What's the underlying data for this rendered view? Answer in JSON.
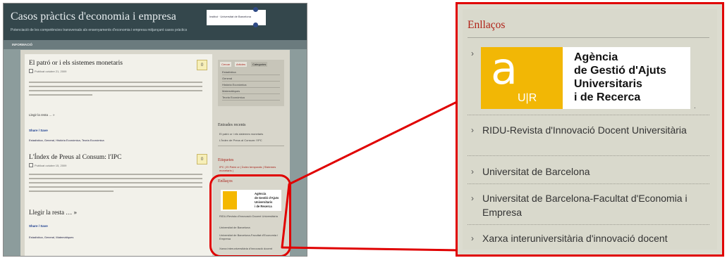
{
  "blog": {
    "title": "Casos pràctics d'economia i empresa",
    "subtitle": "Potenciació de les competències transversals als ensenyaments d'economia i empresa mitjançant casos pràctics",
    "nav": "INFORMACIÓ",
    "logo_text": "Institut · Universitat de Barcelona",
    "posts": [
      {
        "title": "El patró or i els sistemes monetaris",
        "date": "Publicat octubre 21, 2009",
        "comments": "0",
        "read_more": "Llegir la resta … »",
        "share": "Share / Save",
        "tags": "Estadística, General, Història Econòmica, Teoria Econòmica"
      },
      {
        "title": "L'Índex de Preus al Consum: l'IPC",
        "date": "Publicat octubre 15, 2009",
        "comments": "0",
        "read_more": "Llegir la resta … »",
        "share": "Share / Save",
        "tags": "Estadística, General, Matemàtiques"
      }
    ],
    "sidebar": {
      "tabs": [
        "Cercar",
        "Articles",
        "Categories"
      ],
      "categories": [
        "Estadística",
        "General",
        "Història Econòmica",
        "Matemàtiques",
        "Teoria Econòmica"
      ],
      "recent_heading": "Entrades recents",
      "recent": [
        "El patró or i els sistemes monetaris",
        "L'Índex de Preus al Consum: l'IPC"
      ],
      "tags_heading": "Etiquetes",
      "tags_text": "IPC | El Patró or | Índex temporals | Sistemes monetaris |",
      "links_heading": "Enllaços",
      "agency_lines": [
        "Agència",
        "de Gestió d'Ajuts",
        "Universitaris",
        "i de Recerca"
      ],
      "links": [
        "RIDU-Revista d'Innovació Docent Universitària",
        "Universitat de Barcelona",
        "Universitat de Barcelona-Facultat d'Economia i Empresa",
        "Xarxa interuniversitària d'innovació docent"
      ]
    }
  },
  "zoom": {
    "heading": "Enllaços",
    "agency": {
      "letter": "a",
      "short": "U|R",
      "lines": [
        "Agència",
        "de Gestió d'Ajuts",
        "Universitaris",
        "i de Recerca"
      ]
    },
    "links": [
      "RIDU-Revista d'Innovació Docent Universitària",
      "Universitat de Barcelona",
      "Universitat de Barcelona-Facultat d'Economia i Empresa",
      "Xarxa interuniversitària d'innovació docent"
    ],
    "chevron": "›",
    "trailing_dot": "."
  },
  "colors": {
    "highlight": "#e00000",
    "heading_red": "#b02218",
    "agency_yellow": "#f2b705",
    "header_dark": "#34474c"
  }
}
